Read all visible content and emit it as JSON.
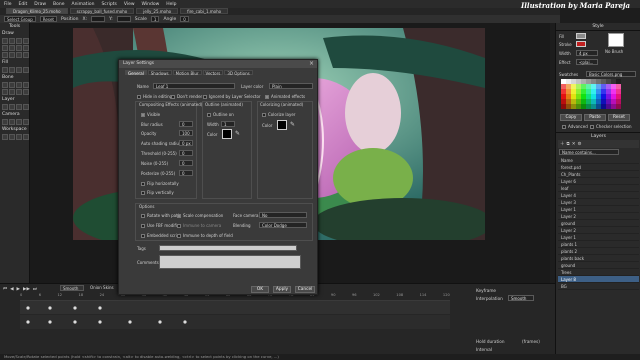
{
  "menubar": {
    "items": [
      "File",
      "Edit",
      "Draw",
      "Bone",
      "Animation",
      "Scripts",
      "View",
      "Window",
      "Help"
    ],
    "credit": "Illustration by Maria Pareja"
  },
  "tabs": [
    "Dragon_Klimo_25.moho",
    "scrappy_ball_fused.moho",
    "jelly_25.moho",
    "fire_cabi_1.moho"
  ],
  "toolbar": {
    "select_group": "Select Group",
    "reset": "Reset",
    "position_label": "Position",
    "x": "X:",
    "y": "Y:",
    "scale_label": "Scale",
    "scale_val": "1",
    "angle_label": "Angle",
    "angle_val": "0"
  },
  "leftpanel": {
    "tools": "Tools",
    "draw": "Draw",
    "fill": "Fill",
    "bone": "Bone",
    "layer": "Layer",
    "camera": "Camera",
    "workspace": "Workspace"
  },
  "dialog": {
    "title": "Layer Settings",
    "tabs": [
      "General",
      "Shadows",
      "Motion Blur",
      "Vectors",
      "3D Options"
    ],
    "name_label": "Name",
    "name_value": "Leaf 1",
    "layer_color_label": "Layer color",
    "layer_color_value": "Plain",
    "hide_editing": "Hide in editing",
    "dont_render": "Don't render",
    "ignored_selector": "Ignored by Layer Selector",
    "animated_effects": "Animated effects",
    "compositing": "Compositing Effects (animated)",
    "outline": "Outline (animated)",
    "colorizing": "Colorizing (animated)",
    "visible": "Visible",
    "blur_radius": "Blur radius",
    "blur_val": "0",
    "opacity": "Opacity",
    "opacity_val": "100",
    "auto_shading": "Auto shading radius",
    "auto_val": "0 px",
    "threshold": "Threshold (0-255)",
    "threshold_val": "0",
    "noise": "Noise (0-255)",
    "noise_val": "0",
    "posterize": "Posterize (0-255)",
    "posterize_val": "0",
    "flip_h": "Flip horizontally",
    "flip_v": "Flip vertically",
    "outline_on": "Outline on",
    "width": "Width",
    "width_val": "1",
    "color": "Color",
    "colorize_layer": "Colorize layer",
    "color2": "Color",
    "options": "Options",
    "rotate_path": "Rotate with path",
    "scale_comp": "Scale compensation",
    "face_camera": "Face camera",
    "face_val": "No",
    "use_fbf": "Use FBF modifier",
    "immune_camera": "Immune to camera",
    "blending": "Blending",
    "blending_val": "Color Dodge",
    "embedded_script": "Embedded script",
    "immune_dof": "Immune to depth of field",
    "tags": "Tags",
    "comments": "Comments",
    "ok": "OK",
    "apply": "Apply",
    "cancel": "Cancel"
  },
  "right": {
    "style": "Style",
    "fill": "Fill",
    "stroke": "Stroke",
    "width": "Width",
    "width_val": "4 px",
    "no_brush": "No Brush",
    "effect": "Effect",
    "effect_val": "<plai...",
    "swatches": "Swatches",
    "swatch_set": "Basic Colors.png",
    "copy": "Copy",
    "paste": "Paste",
    "reset": "Reset",
    "advanced": "Advanced",
    "checker": "Checker selection",
    "layers": "Layers",
    "layer_search": "Name contains...",
    "layers_list": [
      "Name",
      "forest.psd",
      "Ch_Plants",
      "Layer 6",
      "leaf",
      "Layer 4",
      "Layer 3",
      "Layer 1",
      "Layer 2",
      "ground",
      "Layer 2",
      "Layer 1",
      "plants 1",
      "plants 2",
      "plants back",
      "ground",
      "Trees",
      "Layer 8",
      "BG"
    ],
    "selected_index": 17
  },
  "timeline": {
    "smooth": "Smooth",
    "onion": "Onion Skins",
    "relative": "Relative keyframing",
    "keyframe": "Keyframe",
    "interpolation": "Interpolation",
    "interp_val": "Smooth",
    "hold": "Hold duration",
    "frames": "(frames)",
    "interval": "Interval",
    "ticks": [
      "0",
      "6",
      "12",
      "18",
      "24",
      "30",
      "36",
      "42",
      "48",
      "54",
      "60",
      "66",
      "72",
      "78",
      "84",
      "90",
      "96",
      "102",
      "108",
      "114",
      "120"
    ]
  },
  "status": "Move/Scale/Rotate selected points (hold <shift> to constrain, <alt> to disable auto-welding, <ctrl> to select points by clicking on the curve, ...)",
  "colors": {
    "accent": "#3d5f85",
    "panel": "#2a2a2a",
    "dialog": "#3a3a3a"
  }
}
